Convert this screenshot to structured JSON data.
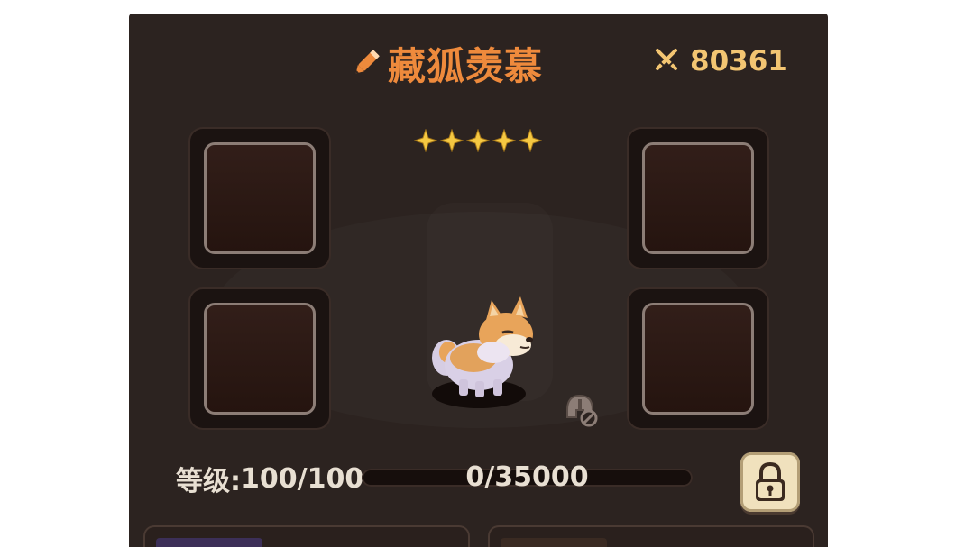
{
  "pet": {
    "name": "藏狐羡慕",
    "power": "80361",
    "stars": 5,
    "level_label": "等级:",
    "level_value": "100/100",
    "exp_text": "0/35000",
    "exp_fraction": 0,
    "locked": true
  },
  "equipment_slots": [
    {
      "position": "top-left",
      "empty": true
    },
    {
      "position": "top-right",
      "empty": true
    },
    {
      "position": "bottom-left",
      "empty": true
    },
    {
      "position": "bottom-right",
      "empty": true
    }
  ],
  "icons": {
    "rename": "pencil-icon",
    "power": "crossed-swords-icon",
    "star": "star-icon",
    "lock": "padlock-icon",
    "no_equip": "helmet-blocked-icon"
  },
  "colors": {
    "panel": "#2c2320",
    "name": "#ee8a3c",
    "power": "#f3c572",
    "star": "#f5c842",
    "lock_button": "#f0e1bd"
  }
}
